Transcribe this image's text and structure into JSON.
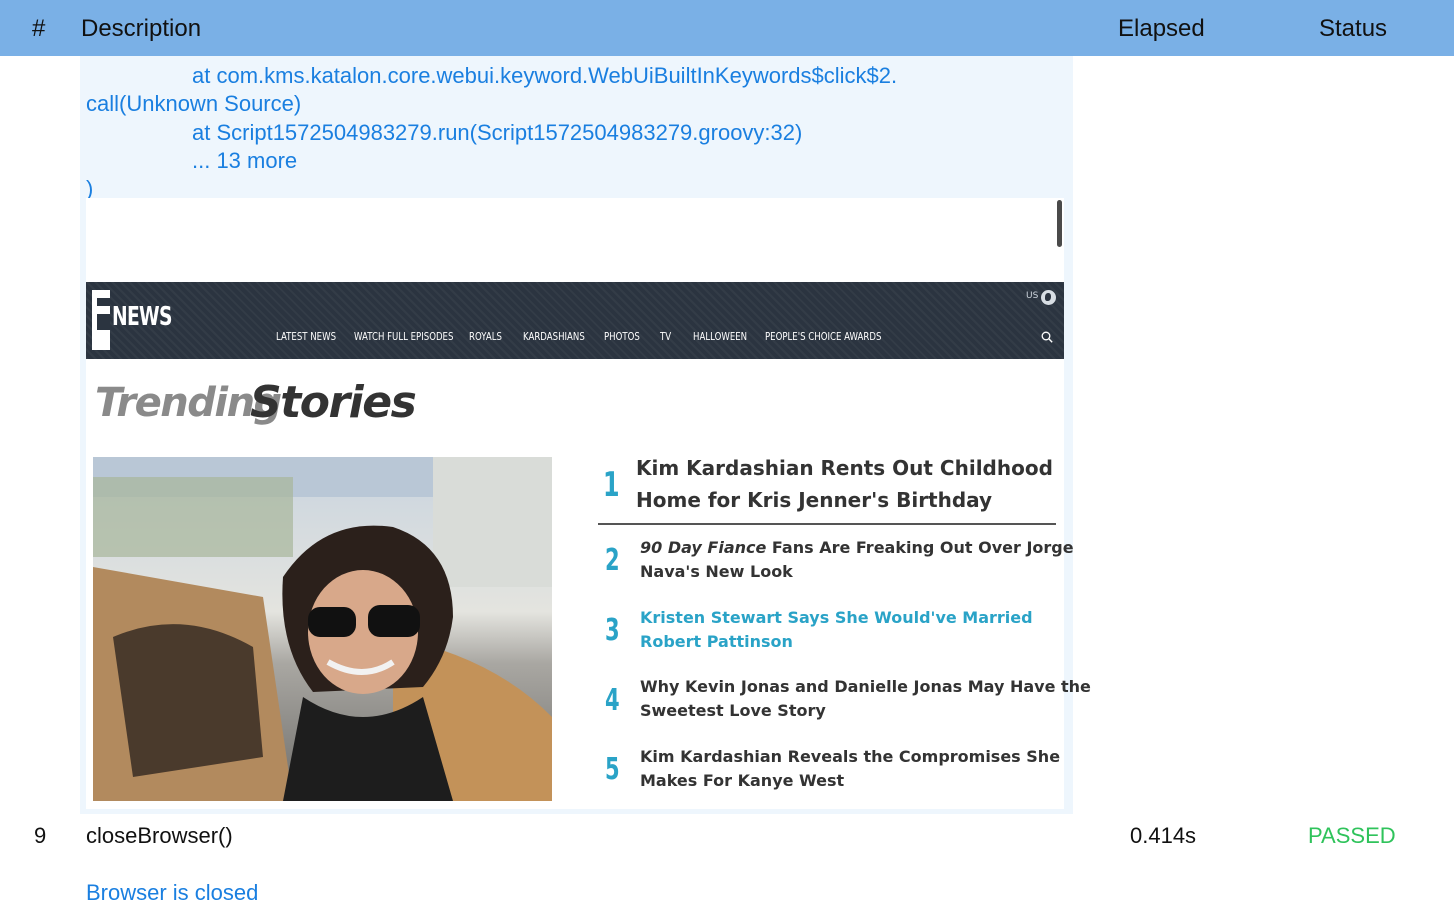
{
  "table_header": {
    "num": "#",
    "description": "Description",
    "elapsed": "Elapsed",
    "status": "Status"
  },
  "log_lines": [
    "at com.kms.katalon.core.webui.keyword.WebUiBuiltInKeywords$click$2.",
    "call(Unknown Source)",
    "at Script1572504983279.run(Script1572504983279.groovy:32)",
    "... 13 more",
    ")"
  ],
  "screenshot": {
    "nav": {
      "logo_text": "NEWS",
      "items": [
        "LATEST NEWS",
        "WATCH FULL EPISODES",
        "ROYALS",
        "KARDASHIANS",
        "PHOTOS",
        "TV",
        "HALLOWEEN",
        "PEOPLE'S CHOICE AWARDS"
      ],
      "region": "US"
    },
    "trending": {
      "word1": "Trending",
      "word2": "Stories"
    },
    "stories": [
      {
        "num": "1",
        "line1": "Kim Kardashian Rents Out Childhood",
        "line2": "Home for Kris Jenner's Birthday"
      },
      {
        "num": "2",
        "italic": "90 Day Fiance",
        "line1": " Fans Are Freaking Out Over Jorge",
        "line2": "Nava's New Look"
      },
      {
        "num": "3",
        "line1": "Kristen Stewart Says She Would've Married",
        "line2": "Robert Pattinson"
      },
      {
        "num": "4",
        "line1": "Why Kevin Jonas and Danielle Jonas May Have the",
        "line2": "Sweetest Love Story"
      },
      {
        "num": "5",
        "line1": "Kim Kardashian Reveals the Compromises She",
        "line2": "Makes For Kanye West"
      }
    ]
  },
  "step": {
    "num": "9",
    "description": "closeBrowser()",
    "elapsed": "0.414s",
    "status": "PASSED",
    "message": "Browser is closed"
  },
  "colors": {
    "header_bg": "#7ab0e6",
    "link_blue": "#1a7fe0",
    "passed_green": "#2fc35b",
    "enews_accent": "#2aa3c7"
  }
}
